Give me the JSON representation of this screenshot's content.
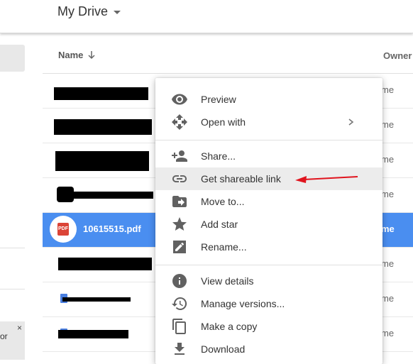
{
  "header": {
    "title": "My Drive"
  },
  "columns": {
    "name": "Name",
    "owner": "Owner"
  },
  "left_panel": {
    "note_text": "or",
    "note_close": "×"
  },
  "files": [
    {
      "name": "",
      "owner": "me",
      "selected": false
    },
    {
      "name": "",
      "owner": "me",
      "selected": false
    },
    {
      "name": "",
      "owner": "me",
      "selected": false
    },
    {
      "name": "",
      "owner": "me",
      "selected": false
    },
    {
      "name": "10615515.pdf",
      "owner": "me",
      "selected": true,
      "icon": "pdf-icon",
      "icon_text": "PDF"
    },
    {
      "name": "",
      "owner": "me",
      "selected": false
    },
    {
      "name": "",
      "owner": "me",
      "selected": false
    },
    {
      "name": "",
      "owner": "me",
      "selected": false
    }
  ],
  "context_menu": {
    "items": [
      {
        "label": "Preview",
        "icon": "eye-icon"
      },
      {
        "label": "Open with",
        "icon": "move-arrows-icon",
        "has_submenu": true
      },
      {
        "label": "Share...",
        "icon": "add-person-icon"
      },
      {
        "label": "Get shareable link",
        "icon": "link-icon",
        "highlighted": true
      },
      {
        "label": "Move to...",
        "icon": "folder-move-icon"
      },
      {
        "label": "Add star",
        "icon": "star-icon"
      },
      {
        "label": "Rename...",
        "icon": "rename-icon"
      },
      {
        "label": "View details",
        "icon": "info-icon"
      },
      {
        "label": "Manage versions...",
        "icon": "history-icon"
      },
      {
        "label": "Make a copy",
        "icon": "copy-icon"
      },
      {
        "label": "Download",
        "icon": "download-icon"
      }
    ]
  },
  "colors": {
    "selection": "#4a8ef0",
    "annotation_arrow": "#e0141e",
    "icon_gray": "#616161"
  }
}
